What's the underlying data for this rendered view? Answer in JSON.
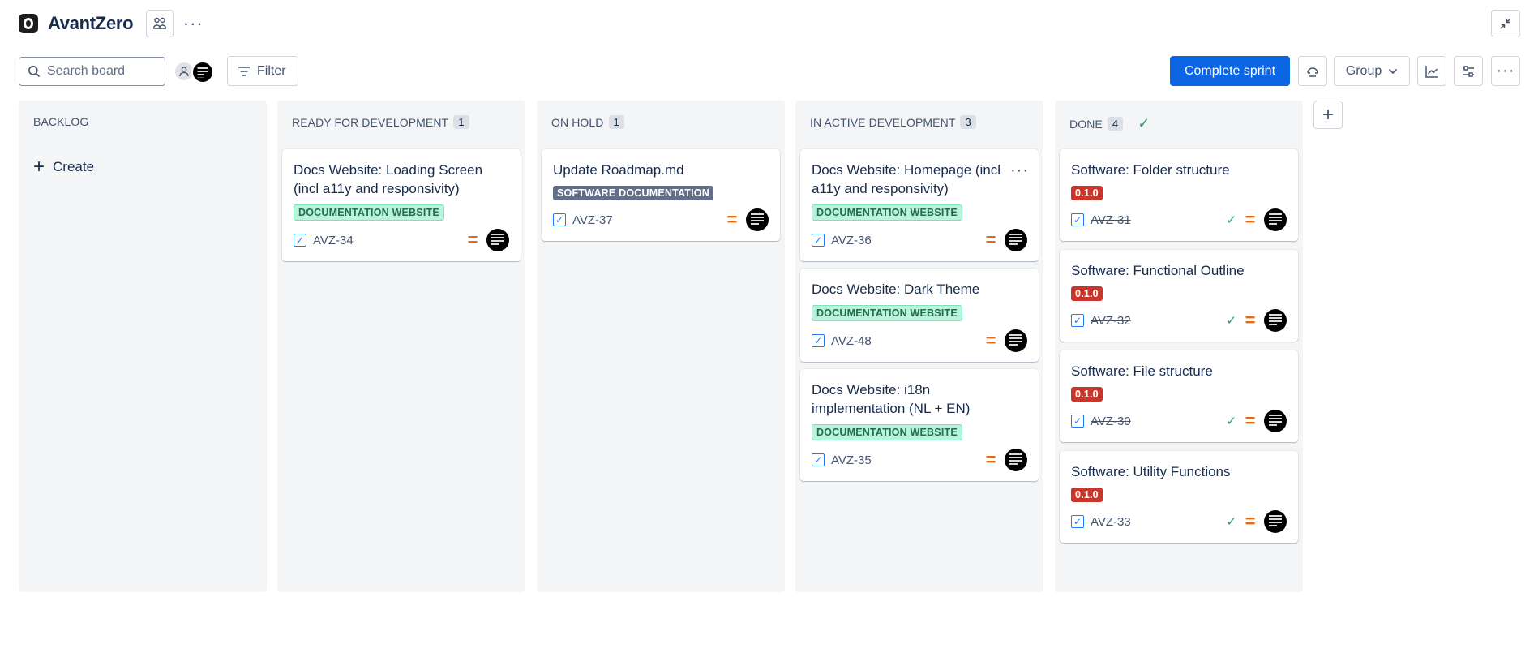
{
  "header": {
    "title": "AvantZero",
    "more_label": "···"
  },
  "toolbar": {
    "search_placeholder": "Search board",
    "filter_label": "Filter",
    "complete_sprint_label": "Complete sprint",
    "group_label": "Group"
  },
  "columns": [
    {
      "name": "BACKLOG",
      "count": "",
      "create_label": "Create"
    },
    {
      "name": "READY FOR DEVELOPMENT",
      "count": "1"
    },
    {
      "name": "ON HOLD",
      "count": "1"
    },
    {
      "name": "IN ACTIVE DEVELOPMENT",
      "count": "3"
    },
    {
      "name": "DONE",
      "count": "4"
    }
  ],
  "cards": {
    "ready": [
      {
        "title": "Docs Website: Loading Screen (incl a11y and responsivity)",
        "label": "DOCUMENTATION WEBSITE",
        "key": "AVZ-34"
      }
    ],
    "hold": [
      {
        "title": "Update Roadmap.md",
        "label": "SOFTWARE DOCUMENTATION",
        "key": "AVZ-37"
      }
    ],
    "active": [
      {
        "title": "Docs Website: Homepage (incl a11y and responsivity)",
        "label": "DOCUMENTATION WEBSITE",
        "key": "AVZ-36"
      },
      {
        "title": "Docs Website: Dark Theme",
        "label": "DOCUMENTATION WEBSITE",
        "key": "AVZ-48"
      },
      {
        "title": "Docs Website: i18n implementation (NL + EN)",
        "label": "DOCUMENTATION WEBSITE",
        "key": "AVZ-35"
      }
    ],
    "done": [
      {
        "title": "Software: Folder structure",
        "label": "0.1.0",
        "key": "AVZ-31"
      },
      {
        "title": "Software: Functional Outline",
        "label": "0.1.0",
        "key": "AVZ-32"
      },
      {
        "title": "Software: File structure",
        "label": "0.1.0",
        "key": "AVZ-30"
      },
      {
        "title": "Software: Utility Functions",
        "label": "0.1.0",
        "key": "AVZ-33"
      }
    ]
  },
  "colors": {
    "primary": "#0c66e4",
    "priority_medium": "#e56910",
    "label_green_bg": "#baf3db",
    "label_green_text": "#216e4e",
    "version_red": "#c9372c",
    "done_green": "#22a06b"
  }
}
